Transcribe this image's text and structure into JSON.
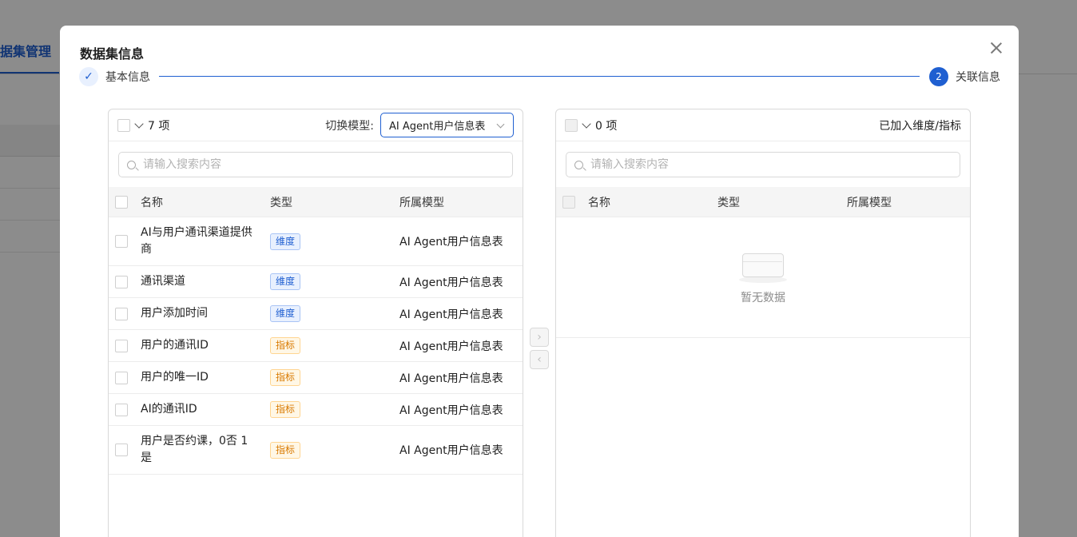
{
  "background": {
    "tab_label": "据集管理"
  },
  "modal": {
    "title": "数据集信息",
    "steps": [
      {
        "label": "基本信息",
        "status": "finished",
        "icon": "check-icon"
      },
      {
        "label": "关联信息",
        "status": "current",
        "number": "2"
      }
    ]
  },
  "left_panel": {
    "count_text": "7 项",
    "switch_label": "切换模型:",
    "selected_model": "AI Agent用户信息表",
    "search_placeholder": "请输入搜索内容",
    "columns": {
      "name": "名称",
      "type": "类型",
      "model": "所属模型"
    },
    "rows": [
      {
        "name": "AI与用户通讯渠道提供商",
        "type": "维度",
        "kind": "dimension",
        "model": "AI Agent用户信息表"
      },
      {
        "name": "通讯渠道",
        "type": "维度",
        "kind": "dimension",
        "model": "AI Agent用户信息表"
      },
      {
        "name": "用户添加时间",
        "type": "维度",
        "kind": "dimension",
        "model": "AI Agent用户信息表"
      },
      {
        "name": "用户的通讯ID",
        "type": "指标",
        "kind": "metric",
        "model": "AI Agent用户信息表"
      },
      {
        "name": "用户的唯一ID",
        "type": "指标",
        "kind": "metric",
        "model": "AI Agent用户信息表"
      },
      {
        "name": "AI的通讯ID",
        "type": "指标",
        "kind": "metric",
        "model": "AI Agent用户信息表"
      },
      {
        "name": "用户是否约课，0否 1是",
        "type": "指标",
        "kind": "metric",
        "model": "AI Agent用户信息表"
      }
    ]
  },
  "right_panel": {
    "count_text": "0 项",
    "title": "已加入维度/指标",
    "search_placeholder": "请输入搜索内容",
    "columns": {
      "name": "名称",
      "type": "类型",
      "model": "所属模型"
    },
    "empty_text": "暂无数据"
  },
  "operations": {
    "move_right": "›",
    "move_left": "‹"
  }
}
